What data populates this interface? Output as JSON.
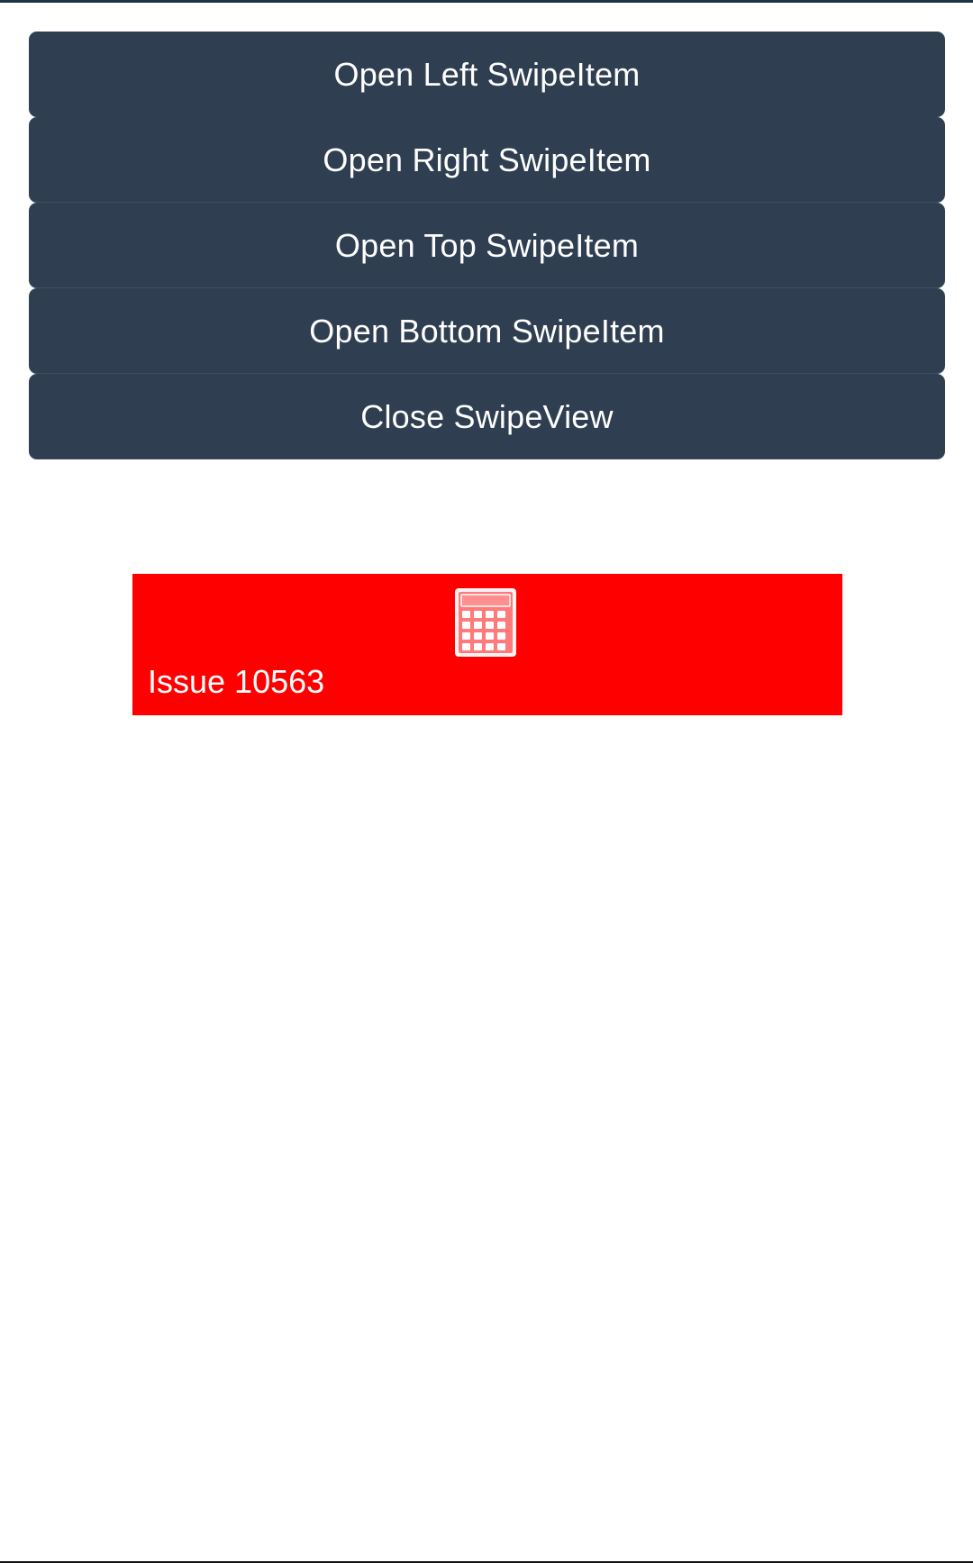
{
  "buttons": {
    "open_left": "Open Left SwipeItem",
    "open_right": "Open Right SwipeItem",
    "open_top": "Open Top SwipeItem",
    "open_bottom": "Open Bottom SwipeItem",
    "close": "Close SwipeView"
  },
  "swipe_view": {
    "label": "Issue 10563",
    "icon": "calculator-icon",
    "background_color": "#FF0000"
  },
  "colors": {
    "button_background": "#2F3F51",
    "button_text": "#FFFFFF",
    "page_background": "#FFFFFF"
  }
}
